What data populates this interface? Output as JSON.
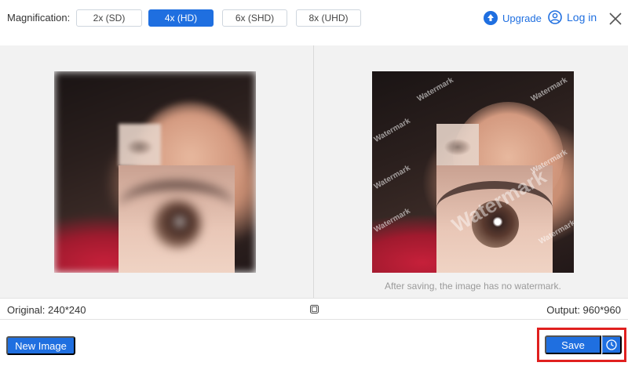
{
  "header": {
    "magnification_label": "Magnification:",
    "options": [
      {
        "label": "2x (SD)",
        "active": false
      },
      {
        "label": "4x (HD)",
        "active": true
      },
      {
        "label": "6x (SHD)",
        "active": false
      },
      {
        "label": "8x (UHD)",
        "active": false
      }
    ],
    "upgrade_label": "Upgrade",
    "login_label": "Log in"
  },
  "preview": {
    "watermark_text": "Watermark",
    "watermark_note": "After saving, the image has no watermark."
  },
  "info": {
    "original": "Original: 240*240",
    "output": "Output: 960*960"
  },
  "footer": {
    "new_image_label": "New Image",
    "save_label": "Save"
  },
  "colors": {
    "accent": "#1f6fe0",
    "highlight_border": "#e0201f"
  }
}
